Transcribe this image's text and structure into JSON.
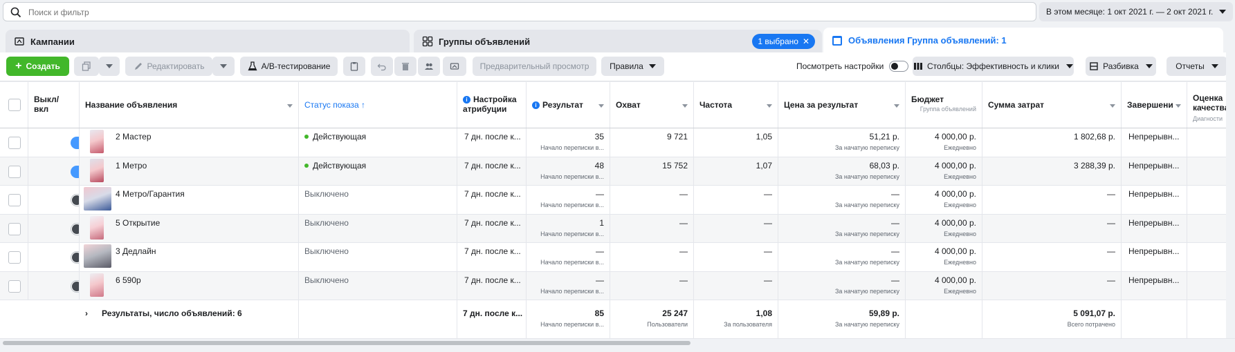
{
  "search": {
    "placeholder": "Поиск и фильтр"
  },
  "date_range": {
    "label": "В этом месяце: 1 окт 2021 г. — 2 окт 2021 г."
  },
  "tabs": [
    {
      "label": "Кампании"
    },
    {
      "label": "Группы объявлений",
      "pill": "1 выбрано"
    },
    {
      "label": "Объявления Группа объявлений: 1"
    }
  ],
  "toolbar": {
    "create": "Создать",
    "edit": "Редактировать",
    "ab_test": "A/B-тестирование",
    "preview": "Предварительный просмотр",
    "rules": "Правила",
    "view_settings": "Посмотреть настройки",
    "columns": "Столбцы: Эффективность и клики",
    "breakdown": "Разбивка",
    "reports": "Отчеты"
  },
  "headers": {
    "toggle": "Выкл/ вкл",
    "name": "Название объявления",
    "status": "Статус показа ↑",
    "attribution": "Настройка атрибуции",
    "result": "Результат",
    "reach": "Охват",
    "frequency": "Частота",
    "cost_per_result": "Цена за результат",
    "budget": "Бюджет",
    "budget_sub": "Группа объявлений",
    "amount_spent": "Сумма затрат",
    "ends": "Завершени",
    "quality": "Оценка качества",
    "quality_sub": "Диагности"
  },
  "rows": [
    {
      "on": true,
      "name": "2 Мастер",
      "status": "Действующая",
      "attribution": "7 дн. после к...",
      "result": "35",
      "result_sub": "Начало переписки в...",
      "reach": "9 721",
      "frequency": "1,05",
      "cost": "51,21 р.",
      "cost_sub": "За начатую переписку",
      "budget": "4 000,00 р.",
      "budget_sub": "Ежедневно",
      "spent": "1 802,68 р.",
      "ends": "Непрерывн..."
    },
    {
      "on": true,
      "name": "1 Метро",
      "status": "Действующая",
      "attribution": "7 дн. после к...",
      "result": "48",
      "result_sub": "Начало переписки в...",
      "reach": "15 752",
      "frequency": "1,07",
      "cost": "68,03 р.",
      "cost_sub": "За начатую переписку",
      "budget": "4 000,00 р.",
      "budget_sub": "Ежедневно",
      "spent": "3 288,39 р.",
      "ends": "Непрерывн..."
    },
    {
      "on": false,
      "name": "4 Метро/Гарантия",
      "status": "Выключено",
      "attribution": "7 дн. после к...",
      "result": "—",
      "result_sub": "Начало переписки в...",
      "reach": "—",
      "frequency": "—",
      "cost": "—",
      "cost_sub": "За начатую переписку",
      "budget": "4 000,00 р.",
      "budget_sub": "Ежедневно",
      "spent": "—",
      "ends": "Непрерывн..."
    },
    {
      "on": false,
      "name": "5 Открытие",
      "status": "Выключено",
      "attribution": "7 дн. после к...",
      "result": "1",
      "result_sub": "Начало переписки в...",
      "reach": "—",
      "frequency": "—",
      "cost": "—",
      "cost_sub": "За начатую переписку",
      "budget": "4 000,00 р.",
      "budget_sub": "Ежедневно",
      "spent": "—",
      "ends": "Непрерывн..."
    },
    {
      "on": false,
      "name": "3 Дедлайн",
      "status": "Выключено",
      "attribution": "7 дн. после к...",
      "result": "—",
      "result_sub": "Начало переписки в...",
      "reach": "—",
      "frequency": "—",
      "cost": "—",
      "cost_sub": "За начатую переписку",
      "budget": "4 000,00 р.",
      "budget_sub": "Ежедневно",
      "spent": "—",
      "ends": "Непрерывн..."
    },
    {
      "on": false,
      "name": "6 590р",
      "status": "Выключено",
      "attribution": "7 дн. после к...",
      "result": "—",
      "result_sub": "Начало переписки в...",
      "reach": "—",
      "frequency": "—",
      "cost": "—",
      "cost_sub": "За начатую переписку",
      "budget": "4 000,00 р.",
      "budget_sub": "Ежедневно",
      "spent": "—",
      "ends": "Непрерывн..."
    }
  ],
  "totals": {
    "label": "Результаты, число объявлений: 6",
    "attribution": "7 дн. после к...",
    "result": "85",
    "result_sub": "Начало переписки в...",
    "reach": "25 247",
    "reach_sub": "Пользователи",
    "frequency": "1,08",
    "frequency_sub": "За пользователя",
    "cost": "59,89 р.",
    "cost_sub": "За начатую переписку",
    "spent": "5 091,07 р.",
    "spent_sub": "Всего потрачено"
  },
  "colors": {
    "accent": "#1877f2",
    "create": "#42b72a",
    "active_dot": "#42b72a"
  }
}
